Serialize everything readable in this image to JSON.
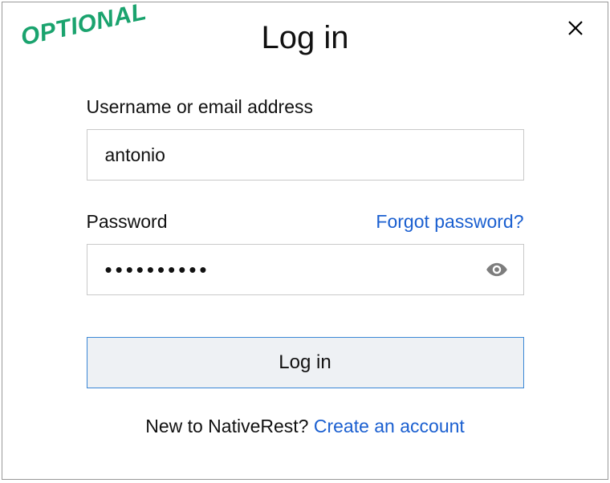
{
  "watermark": "OPTIONAL",
  "title": "Log in",
  "username": {
    "label": "Username or email address",
    "value": "antonio"
  },
  "password": {
    "label": "Password",
    "forgot_label": "Forgot password?",
    "masked_value": "••••••••••"
  },
  "login_button": "Log in",
  "signup": {
    "prefix": "New to NativeRest? ",
    "link": "Create an account"
  }
}
